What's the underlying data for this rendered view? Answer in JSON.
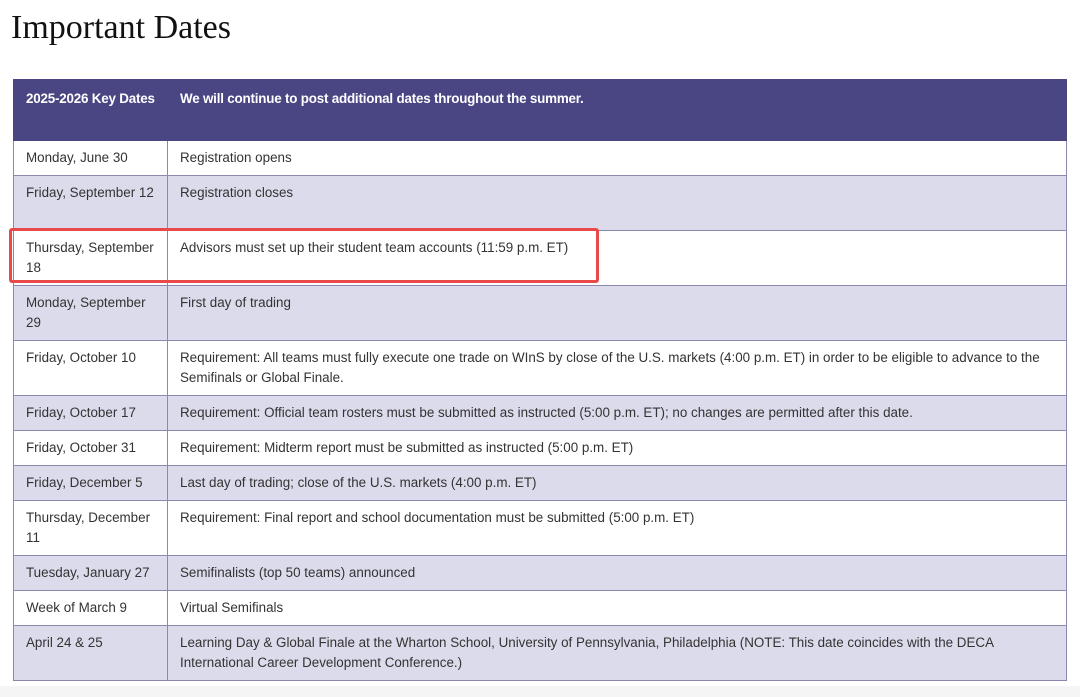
{
  "page": {
    "title": "Important Dates"
  },
  "table": {
    "headers": [
      "2025-2026 Key Dates",
      "We will continue to post additional dates throughout the summer."
    ],
    "rows": [
      {
        "date": "Monday, June 30",
        "event": "Registration opens"
      },
      {
        "date": "Friday, September 12",
        "event": "Registration closes"
      },
      {
        "date": "Thursday, September 18",
        "event": "Advisors must set up their student team accounts (11:59 p.m. ET)"
      },
      {
        "date": "Monday, September 29",
        "event": "First day of trading"
      },
      {
        "date": "Friday, October 10",
        "event": "Requirement: All teams must fully execute one trade on WInS by close of the U.S. markets (4:00 p.m. ET) in order to be eligible to advance to the Semifinals or Global Finale."
      },
      {
        "date": "Friday, October 17",
        "event": "Requirement: Official team rosters must be submitted as instructed (5:00 p.m. ET); no changes are permitted after this date."
      },
      {
        "date": "Friday, October 31",
        "event": "Requirement: Midterm report must be submitted as instructed (5:00 p.m. ET)"
      },
      {
        "date": "Friday, December 5",
        "event": "Last day of trading; close of the U.S. markets (4:00 p.m. ET)"
      },
      {
        "date": "Thursday, December 11",
        "event": "Requirement: Final report and school documentation must be submitted (5:00 p.m. ET)"
      },
      {
        "date": "Tuesday, January 27",
        "event": "Semifinalists (top 50 teams) announced"
      },
      {
        "date": "Week of March 9",
        "event": "Virtual Semifinals"
      },
      {
        "date": "April 24 & 25",
        "event": "Learning Day & Global Finale at the Wharton School, University of Pennsylvania, Philadelphia (NOTE: This date coincides with the DECA International Career Development Conference.)"
      }
    ]
  },
  "colors": {
    "header_bg": "#4a4683",
    "alt_row_bg": "#dcdbeb",
    "highlight": "#e84a4a"
  }
}
